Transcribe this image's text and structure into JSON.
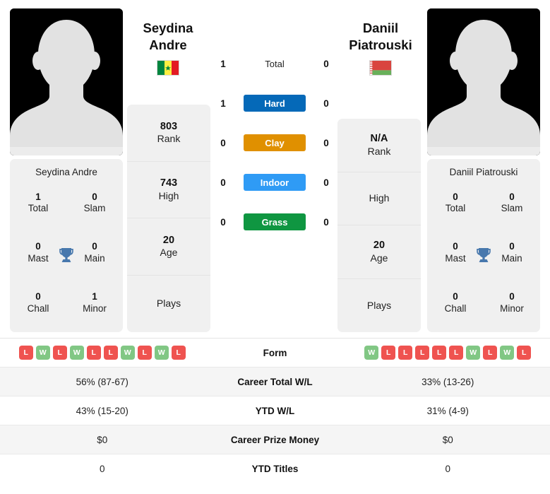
{
  "players": {
    "left": {
      "first_name": "Seydina",
      "last_name": "Andre",
      "full_name": "Seydina Andre",
      "country": "Senegal",
      "flag_icon": "flag-senegal-icon",
      "avatar_icon": "player-avatar-placeholder-icon",
      "trophies": {
        "total_value": "1",
        "total_label": "Total",
        "slam_value": "0",
        "slam_label": "Slam",
        "mast_value": "0",
        "mast_label": "Mast",
        "main_value": "0",
        "main_label": "Main",
        "chall_value": "0",
        "chall_label": "Chall",
        "minor_value": "1",
        "minor_label": "Minor",
        "trophy_icon": "trophy-icon"
      },
      "rankings": [
        {
          "value": "803",
          "label": "Rank"
        },
        {
          "value": "743",
          "label": "High"
        },
        {
          "value": "20",
          "label": "Age"
        },
        {
          "value": "",
          "label": "Plays"
        }
      ],
      "surface_wins": {
        "total": "1",
        "hard": "1",
        "clay": "0",
        "indoor": "0",
        "grass": "0"
      },
      "form": [
        "L",
        "W",
        "L",
        "W",
        "L",
        "L",
        "W",
        "L",
        "W",
        "L"
      ],
      "career_total_wl": "56% (87-67)",
      "ytd_wl": "43% (15-20)",
      "career_prize_money": "$0",
      "ytd_titles": "0"
    },
    "right": {
      "first_name": "Daniil",
      "last_name": "Piatrouski",
      "full_name": "Daniil Piatrouski",
      "country": "Belarus",
      "flag_icon": "flag-belarus-icon",
      "avatar_icon": "player-avatar-placeholder-icon",
      "trophies": {
        "total_value": "0",
        "total_label": "Total",
        "slam_value": "0",
        "slam_label": "Slam",
        "mast_value": "0",
        "mast_label": "Mast",
        "main_value": "0",
        "main_label": "Main",
        "chall_value": "0",
        "chall_label": "Chall",
        "minor_value": "0",
        "minor_label": "Minor",
        "trophy_icon": "trophy-icon"
      },
      "rankings": [
        {
          "value": "N/A",
          "label": "Rank"
        },
        {
          "value": "",
          "label": "High"
        },
        {
          "value": "20",
          "label": "Age"
        },
        {
          "value": "",
          "label": "Plays"
        }
      ],
      "surface_wins": {
        "total": "0",
        "hard": "0",
        "clay": "0",
        "indoor": "0",
        "grass": "0"
      },
      "form": [
        "W",
        "L",
        "L",
        "L",
        "L",
        "L",
        "W",
        "L",
        "W",
        "L"
      ],
      "career_total_wl": "33% (13-26)",
      "ytd_wl": "31% (4-9)",
      "career_prize_money": "$0",
      "ytd_titles": "0"
    }
  },
  "surfaces": [
    {
      "key": "total",
      "label": "Total",
      "color": "",
      "styled": false
    },
    {
      "key": "hard",
      "label": "Hard",
      "color": "#0569b8",
      "styled": true
    },
    {
      "key": "clay",
      "label": "Clay",
      "color": "#e09000",
      "styled": true
    },
    {
      "key": "indoor",
      "label": "Indoor",
      "color": "#2f9bf5",
      "styled": true
    },
    {
      "key": "grass",
      "label": "Grass",
      "color": "#0f9641",
      "styled": true
    }
  ],
  "table_rows": [
    {
      "label": "Form",
      "key": "form"
    },
    {
      "label": "Career Total W/L",
      "key": "career_total_wl"
    },
    {
      "label": "YTD W/L",
      "key": "ytd_wl"
    },
    {
      "label": "Career Prize Money",
      "key": "career_prize_money"
    },
    {
      "label": "YTD Titles",
      "key": "ytd_titles"
    }
  ],
  "colors": {
    "hard": "#0569b8",
    "clay": "#e09000",
    "indoor": "#2f9bf5",
    "grass": "#0f9641",
    "win_badge": "#81c784",
    "loss_badge": "#ef5350",
    "trophy": "#4878ad",
    "card_bg": "#f0f0f0",
    "row_shade": "#f5f5f5"
  }
}
